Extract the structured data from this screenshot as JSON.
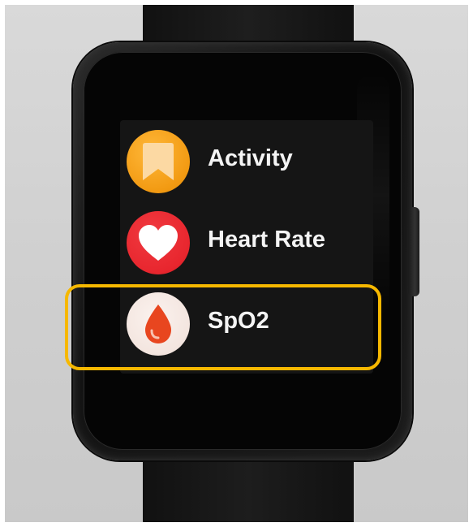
{
  "device": {
    "type": "smartwatch",
    "screen_background": "#151515"
  },
  "menu": {
    "items": [
      {
        "label": "Activity",
        "icon": "bookmark-icon",
        "icon_color": "#f5a623",
        "icon_bg": "#f29a12"
      },
      {
        "label": "Heart Rate",
        "icon": "heart-icon",
        "icon_color": "#ffffff",
        "icon_bg": "#e8262e"
      },
      {
        "label": "SpO2",
        "icon": "blood-drop-icon",
        "icon_color": "#e8461f",
        "icon_bg": "#f3e5df"
      }
    ]
  },
  "annotation": {
    "highlight_color": "#f6b800",
    "highlighted_item": "SpO2"
  }
}
